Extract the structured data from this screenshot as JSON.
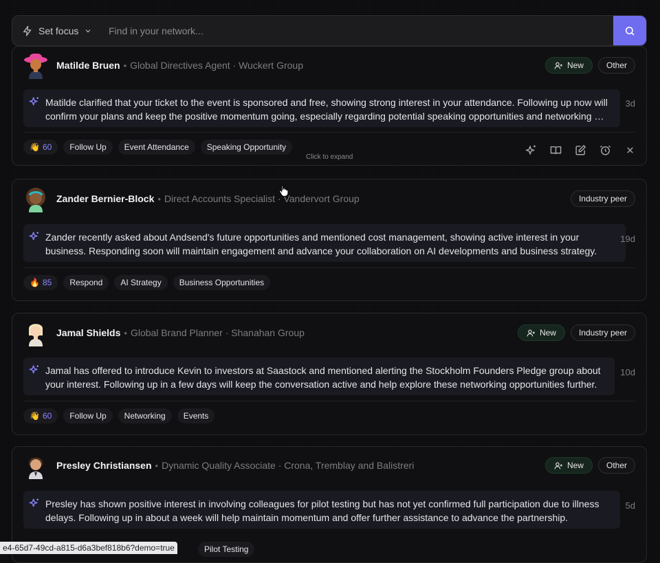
{
  "search": {
    "focus_label": "Set focus",
    "placeholder": "Find in your network..."
  },
  "cards": [
    {
      "name": "Matilde Bruen",
      "role": "Global Directives Agent · Wuckert Group",
      "badges": {
        "new": "New",
        "category": "Other"
      },
      "summary": "Matilde clarified that your ticket to the event is sponsored and free, showing strong interest in your attendance. Following up now will confirm your plans and keep the positive momentum going, especially regarding potential speaking opportunities and networking …",
      "age": "3d",
      "score": {
        "emoji": "👋",
        "value": "60"
      },
      "tags": [
        "Follow Up",
        "Event Attendance",
        "Speaking Opportunity"
      ],
      "hint": "Click to expand"
    },
    {
      "name": "Zander Bernier-Block",
      "role": "Direct Accounts Specialist · Vandervort Group",
      "badges": {
        "category": "Industry peer"
      },
      "summary": "Zander recently asked about Andsend's future opportunities and mentioned cost management, showing active interest in your business. Responding soon will maintain engagement and advance your collaboration on AI developments and business strategy.",
      "age": "19d",
      "score": {
        "emoji": "🔥",
        "value": "85"
      },
      "tags": [
        "Respond",
        "AI Strategy",
        "Business Opportunities"
      ]
    },
    {
      "name": "Jamal Shields",
      "role": "Global Brand Planner · Shanahan Group",
      "badges": {
        "new": "New",
        "category": "Industry peer"
      },
      "summary": "Jamal has offered to introduce Kevin to investors at Saastock and mentioned alerting the Stockholm Founders Pledge group about your interest. Following up in a few days will keep the conversation active and help explore these networking opportunities further.",
      "age": "10d",
      "score": {
        "emoji": "👋",
        "value": "60"
      },
      "tags": [
        "Follow Up",
        "Networking",
        "Events"
      ]
    },
    {
      "name": "Presley Christiansen",
      "role": "Dynamic Quality Associate · Crona, Tremblay and Balistreri",
      "badges": {
        "new": "New",
        "category": "Other"
      },
      "summary": "Presley has shown positive interest in involving colleagues for pilot testing but has not yet confirmed full participation due to illness delays. Following up in about a week will help maintain momentum and offer further assistance to advance the partnership.",
      "age": "5d",
      "tags": [
        "Pilot Testing"
      ]
    }
  ],
  "status_url": "e4-65d7-49cd-a815-d6a3bef818b6?demo=true",
  "colors": {
    "accent": "#6f6cf0",
    "new_badge_bg": "#16251d",
    "score_text": "#8a86ff"
  }
}
